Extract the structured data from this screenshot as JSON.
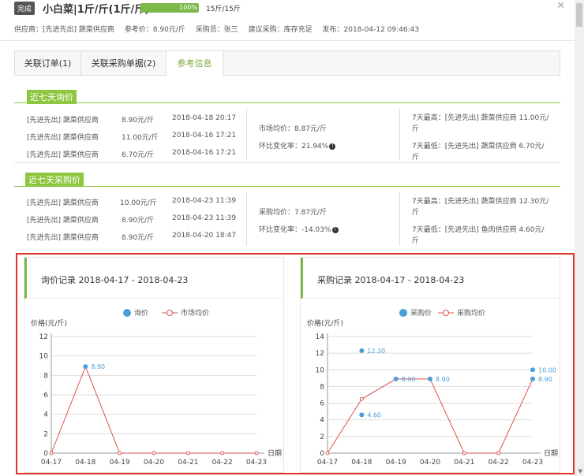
{
  "header": {
    "status_badge": "完成",
    "title": "小白菜|1斤/斤(1斤/斤)",
    "progress_label": "100%",
    "progress_fraction": 1.0,
    "quantity": "15斤/15斤",
    "meta": {
      "supplier": "供应商：[先进先出] 蔬菜供应商",
      "ref_price": "参考价：8.90元/斤",
      "buyer": "采购员：张三",
      "suggestion": "建议采购：库存充足",
      "published": "发布：2018-04-12 09:46:43"
    }
  },
  "tabs": [
    {
      "label": "关联订单(1)"
    },
    {
      "label": "关联采购单据(2)"
    },
    {
      "label": "参考信息"
    }
  ],
  "inquiry": {
    "title": "近七天询价",
    "rows": [
      {
        "supplier": "[先进先出] 蔬菜供应商",
        "price": "8.90元/斤",
        "time": "2018-04-18 20:17"
      },
      {
        "supplier": "[先进先出] 蔬菜供应商",
        "price": "11.00元/斤",
        "time": "2018-04-16 17:21"
      },
      {
        "supplier": "[先进先出] 蔬菜供应商",
        "price": "6.70元/斤",
        "time": "2018-04-16 17:21"
      }
    ],
    "avg": "市场均价：8.87元/斤",
    "change": "环比变化率：21.94%",
    "max": "7天最高：[先进先出] 蔬菜供应商 11.00元/",
    "max_unit": "斤",
    "min": "7天最低：[先进先出] 蔬菜供应商 6.70元/",
    "min_unit": "斤"
  },
  "purchase": {
    "title": "近七天采购价",
    "rows": [
      {
        "supplier": "[先进先出] 蔬菜供应商",
        "price": "10.00元/斤",
        "time": "2018-04-23 11:39"
      },
      {
        "supplier": "[先进先出] 蔬菜供应商",
        "price": "8.90元/斤",
        "time": "2018-04-23 11:39"
      },
      {
        "supplier": "[先进先出] 蔬菜供应商",
        "price": "8.90元/斤",
        "time": "2018-04-20 18:47"
      }
    ],
    "avg": "采购均价：7.87元/斤",
    "change": "环比变化率：-14.03%",
    "max": "7天最高：[先进先出] 蔬菜供应商 12.30元/",
    "max_unit": "斤",
    "min": "7天最低：[先进先出] 鱼肉供应商 4.60元/",
    "min_unit": "斤"
  },
  "chart_data": [
    {
      "type": "line",
      "title": "询价记录 2018-04-17 - 2018-04-23",
      "ylabel": "价格(元/斤)",
      "xlabel": "日期",
      "ylim": [
        0,
        12
      ],
      "yticks": [
        0,
        2,
        4,
        6,
        8,
        10,
        12
      ],
      "categories": [
        "04-17",
        "04-18",
        "04-19",
        "04-20",
        "04-21",
        "04-22",
        "04-23"
      ],
      "legend": [
        "询价",
        "市场均价"
      ],
      "scatter": [
        {
          "x": "04-18",
          "y": 8.9,
          "label": "8.90"
        }
      ],
      "line": [
        0,
        8.9,
        0,
        0,
        0,
        0,
        0
      ],
      "colors": {
        "scatter": "#4a9fd8",
        "line": "#d9534f"
      }
    },
    {
      "type": "line",
      "title": "采购记录 2018-04-17 - 2018-04-23",
      "ylabel": "价格(元/斤)",
      "xlabel": "日期",
      "ylim": [
        0,
        14
      ],
      "yticks": [
        0,
        2,
        4,
        6,
        8,
        10,
        12,
        14
      ],
      "categories": [
        "04-17",
        "04-18",
        "04-19",
        "04-20",
        "04-21",
        "04-22",
        "04-23"
      ],
      "legend": [
        "采购价",
        "采购均价"
      ],
      "scatter": [
        {
          "x": "04-18",
          "y": 12.3,
          "label": "12.30"
        },
        {
          "x": "04-18",
          "y": 4.6,
          "label": "4.60"
        },
        {
          "x": "04-19",
          "y": 8.9,
          "label": "8.90"
        },
        {
          "x": "04-20",
          "y": 8.9,
          "label": "8.90"
        },
        {
          "x": "04-23",
          "y": 10.0,
          "label": "10.00"
        },
        {
          "x": "04-23",
          "y": 8.9,
          "label": "8.90"
        }
      ],
      "line": [
        0,
        6.5,
        8.9,
        8.9,
        0,
        0,
        8.9
      ],
      "colors": {
        "scatter": "#4a9fd8",
        "line": "#d9534f"
      }
    }
  ]
}
